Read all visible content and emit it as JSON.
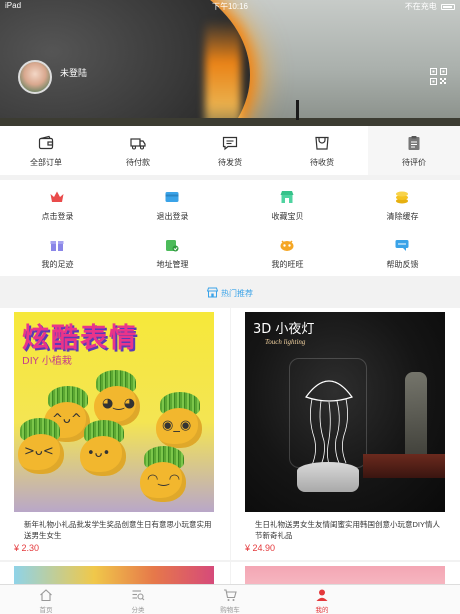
{
  "status_bar": {
    "device": "iPad",
    "time": "下午10:16",
    "charging": "不在充电"
  },
  "profile": {
    "login_text": "未登陆"
  },
  "orders": [
    {
      "label": "全部订单",
      "icon": "wallet-icon"
    },
    {
      "label": "待付款",
      "icon": "truck-icon"
    },
    {
      "label": "待发货",
      "icon": "message-icon"
    },
    {
      "label": "待收货",
      "icon": "box-icon"
    },
    {
      "label": "待评价",
      "icon": "clipboard-icon"
    }
  ],
  "tools": [
    {
      "label": "点击登录",
      "icon": "crown-icon",
      "color": "#e94b4b"
    },
    {
      "label": "退出登录",
      "icon": "logout-icon",
      "color": "#3aa3e8"
    },
    {
      "label": "收藏宝贝",
      "icon": "store-icon",
      "color": "#36c28a"
    },
    {
      "label": "清除缓存",
      "icon": "coins-icon",
      "color": "#f5c320"
    },
    {
      "label": "我的足迹",
      "icon": "gift-icon",
      "color": "#8a86e8"
    },
    {
      "label": "地址管理",
      "icon": "address-icon",
      "color": "#4cbb5a"
    },
    {
      "label": "我的旺旺",
      "icon": "wangwang-icon",
      "color": "#f5a623"
    },
    {
      "label": "帮助反馈",
      "icon": "feedback-icon",
      "color": "#3aa3e8"
    }
  ],
  "section": {
    "title": "热门推荐"
  },
  "products": [
    {
      "title": "新年礼物小礼品批发学生奖品创意生日有意思小玩意实用送男生女生",
      "price": "¥ 2.30",
      "image_text": {
        "headline": "炫酷表情",
        "sub": "DIY 小植栽"
      }
    },
    {
      "title": "生日礼物送男女生友情闺蜜实用韩国创意小玩意DIY情人节新奇礼品",
      "price": "¥ 24.90",
      "image_text": {
        "headline": "3D 小夜灯",
        "sub": "Touch lighting"
      }
    }
  ],
  "tabbar": [
    {
      "label": "首页",
      "icon": "home-icon",
      "active": false
    },
    {
      "label": "分类",
      "icon": "category-search-icon",
      "active": false
    },
    {
      "label": "购物车",
      "icon": "cart-icon",
      "active": false
    },
    {
      "label": "我的",
      "icon": "profile-icon",
      "active": true
    }
  ],
  "colors": {
    "accent_red": "#e4393c",
    "accent_blue": "#3aa3e8"
  }
}
